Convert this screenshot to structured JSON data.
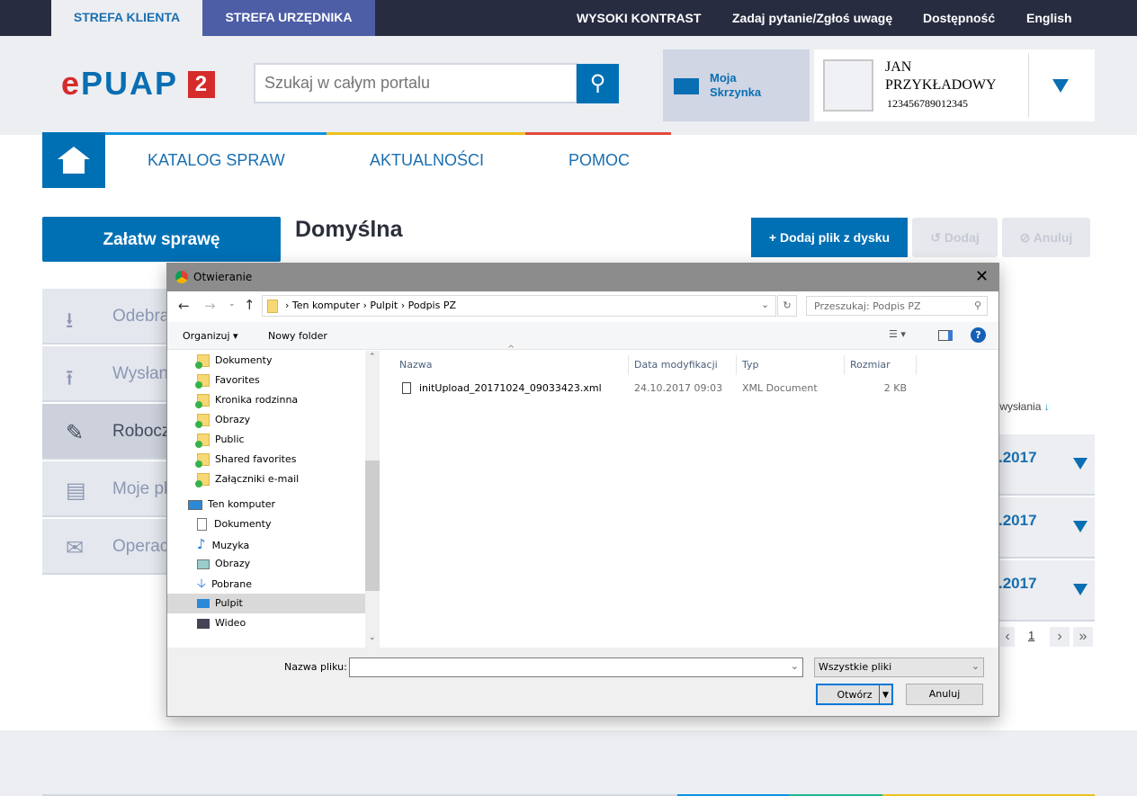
{
  "topbar": {
    "tabs": [
      "STREFA KLIENTA",
      "STREFA URZĘDNIKA"
    ],
    "links": [
      "WYSOKI KONTRAST",
      "Zadaj pytanie/Zgłoś uwagę",
      "Dostępność",
      "English"
    ]
  },
  "header": {
    "logo": "ePUAP 2",
    "search_placeholder": "Szukaj w całym portalu",
    "mailbox": "Moja Skrzynka",
    "user": {
      "first": "JAN",
      "last": "PRZYKŁADOWY",
      "id": "123456789012345"
    }
  },
  "nav": [
    "KATALOG SPRAW",
    "AKTUALNOŚCI",
    "POMOC"
  ],
  "main": {
    "cta": "Załatw sprawę",
    "title": "Domyślna",
    "buttons": {
      "add_file": "Dodaj plik z dysku",
      "add": "Dodaj",
      "cancel": "Anuluj"
    },
    "menu": [
      "Odebra",
      "Wysłan",
      "Robocz",
      "Moje pl",
      "Operac"
    ],
    "sort_label": "ta wysłania",
    "rows": [
      ".2017",
      ".2017",
      ".2017"
    ],
    "page": "1"
  },
  "dialog": {
    "title": "Otwieranie",
    "breadcrumb": [
      "Ten komputer",
      "Pulpit",
      "Podpis PZ"
    ],
    "search_placeholder": "Przeszukaj: Podpis PZ",
    "toolbar": {
      "organize": "Organizuj",
      "new_folder": "Nowy folder"
    },
    "tree": [
      "Dokumenty",
      "Favorites",
      "Kronika rodzinna",
      "Obrazy",
      "Public",
      "Shared favorites",
      "Załączniki e-mail"
    ],
    "computer": "Ten komputer",
    "computer_items": [
      "Dokumenty",
      "Muzyka",
      "Obrazy",
      "Pobrane",
      "Pulpit",
      "Wideo"
    ],
    "columns": [
      "Nazwa",
      "Data modyfikacji",
      "Typ",
      "Rozmiar"
    ],
    "files": [
      {
        "name": "initUpload_20171024_09033423.xml",
        "date": "24.10.2017 09:03",
        "type": "XML Document",
        "size": "2 KB"
      }
    ],
    "filename_label": "Nazwa pliku:",
    "filename": "",
    "filter": "Wszystkie pliki",
    "open": "Otwórz",
    "cancel": "Anuluj"
  }
}
